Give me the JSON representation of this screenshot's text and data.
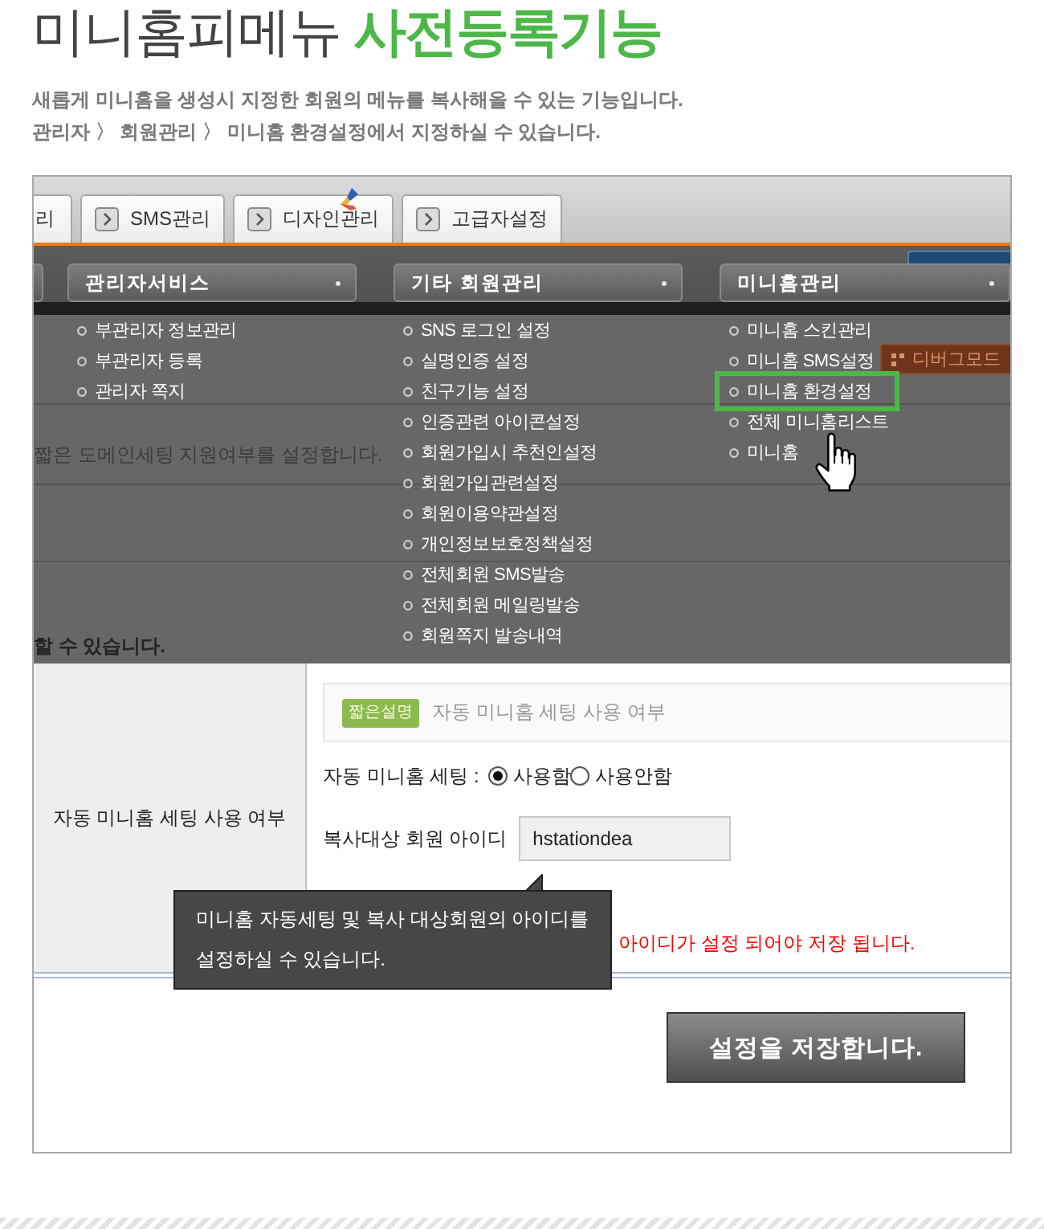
{
  "header": {
    "title": "미니홈피메뉴 **사전등록기능**",
    "description": [
      "새롭게 미니홈을 생성시 지정한 회원의 메뉴를 복사해올 수 있는 기능입니다.",
      "관리자 〉 회원관리 〉 미니홈 환경설정에서 지정하실 수 있습니다."
    ]
  },
  "screenshot": {
    "tabs": [
      {
        "label": "리",
        "kind": "partial",
        "selected": false,
        "sticker": false
      },
      {
        "label": "SMS관리",
        "kind": "normal",
        "selected": false,
        "sticker": false
      },
      {
        "label": "디자인관리",
        "kind": "normal",
        "selected": false,
        "sticker": true
      },
      {
        "label": "고급자설정",
        "kind": "normal",
        "selected": false,
        "sticker": false
      }
    ],
    "page_behind": {
      "note": "짧은 도메인세팅 지원여부를 설정합니다.",
      "bold_note": "할 수 있습니다."
    },
    "menu": {
      "columns": [
        {
          "title": "관리자서비스",
          "items": [
            {
              "label": "부관리자 정보관리",
              "highlighted": false
            },
            {
              "label": "부관리자 등록",
              "highlighted": false
            },
            {
              "label": "관리자 쪽지",
              "highlighted": false
            }
          ]
        },
        {
          "title": "기타 회원관리",
          "items": [
            {
              "label": "SNS 로그인 설정",
              "highlighted": false
            },
            {
              "label": "실명인증 설정",
              "highlighted": false
            },
            {
              "label": "친구기능 설정",
              "highlighted": false
            },
            {
              "label": "인증관련 아이콘설정",
              "highlighted": false
            },
            {
              "label": "회원가입시 추천인설정",
              "highlighted": false
            },
            {
              "label": "회원가입관련설정",
              "highlighted": false
            },
            {
              "label": "회원이용약관설정",
              "highlighted": false
            },
            {
              "label": "개인정보보호정책설정",
              "highlighted": false
            },
            {
              "label": "전체회원 SMS발송",
              "highlighted": false
            },
            {
              "label": "전체회원 메일링발송",
              "highlighted": false
            },
            {
              "label": "회원쪽지 발송내역",
              "highlighted": false
            }
          ]
        },
        {
          "title": "미니홈관리",
          "items": [
            {
              "label": "미니홈 스킨관리",
              "highlighted": false
            },
            {
              "label": "미니홈 SMS설정",
              "highlighted": false
            },
            {
              "label": "미니홈 환경설정",
              "highlighted": true
            },
            {
              "label": "전체 미니홈리스트",
              "highlighted": false
            },
            {
              "label": "미니홈",
              "highlighted": false
            }
          ]
        }
      ],
      "debug_button": "디버그모드"
    },
    "form": {
      "label": "자동 미니홈 세팅 사용 여부",
      "short_description": {
        "badge": "짧은설명",
        "text": "자동 미니홈 세팅 사용 여부"
      },
      "auto_setting": {
        "label": "자동 미니홈 세팅 :",
        "options": [
          {
            "label": "사용함",
            "selected": true
          },
          {
            "label": "사용안함",
            "selected": false
          }
        ]
      },
      "member_id": {
        "label": "복사대상 회원 아이디",
        "value": "hstationdea"
      },
      "warning": "아이디가 설정 되어야 저장 됩니다.",
      "tooltip": "미니홈 자동세팅 및 복사 대상회원의 아이디를\n설정하실 수 있습니다."
    },
    "save_button": "설정을 저장합니다."
  }
}
